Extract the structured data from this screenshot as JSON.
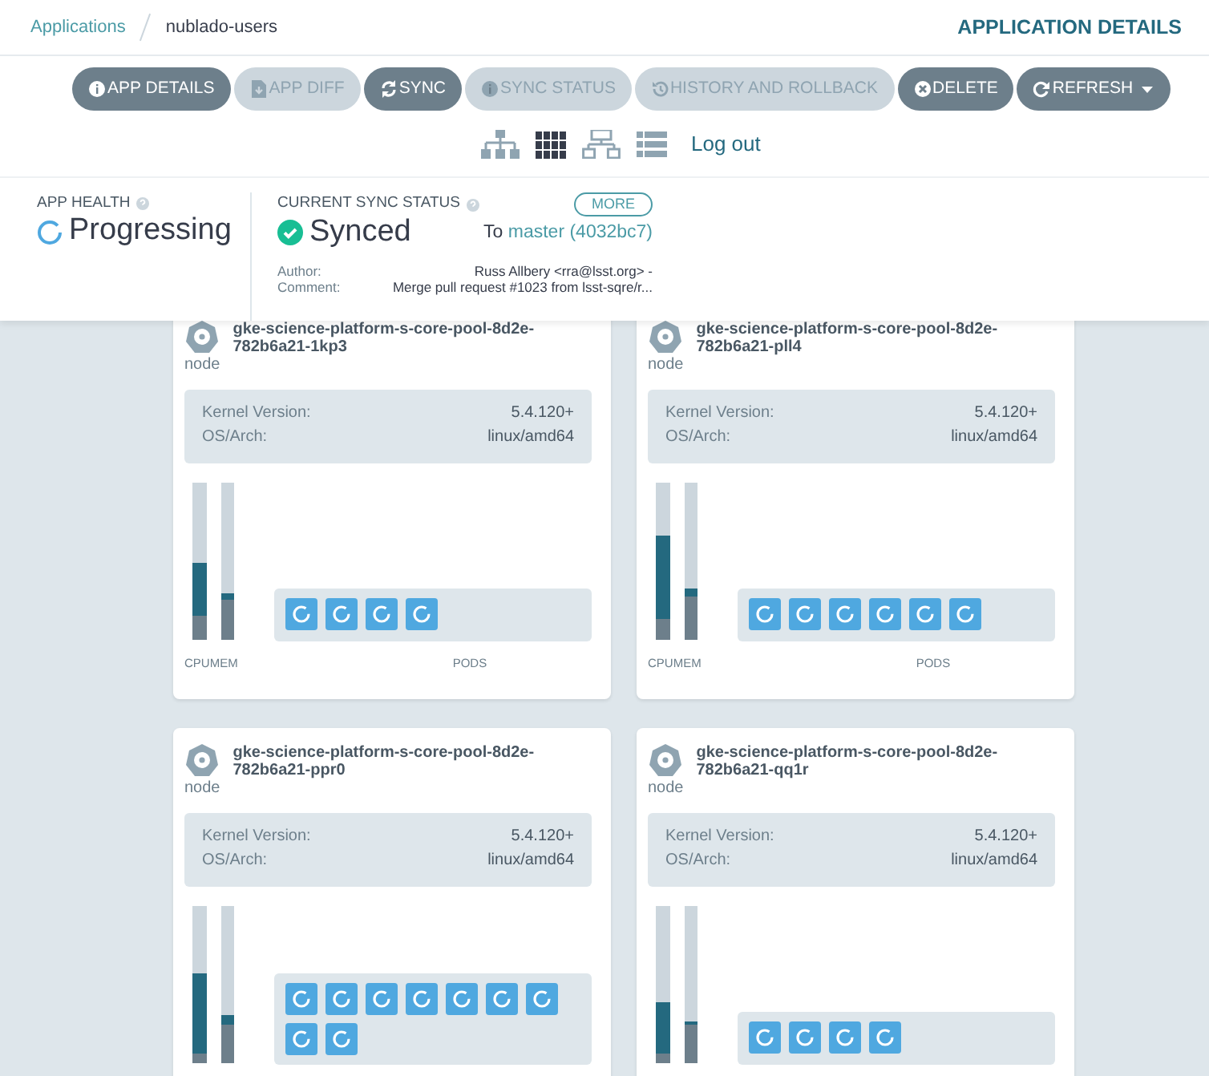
{
  "breadcrumb": {
    "items": [
      {
        "label": "Applications",
        "kind": "link"
      },
      {
        "label": "nublado-users",
        "kind": "current"
      }
    ],
    "page_title": "APPLICATION DETAILS"
  },
  "toolbar": [
    {
      "label": "APP DETAILS",
      "kind": "info",
      "disabled": false
    },
    {
      "label": "APP DIFF",
      "kind": "file",
      "disabled": true
    },
    {
      "label": "SYNC",
      "kind": "sync",
      "disabled": false
    },
    {
      "label": "SYNC STATUS",
      "kind": "info",
      "disabled": true
    },
    {
      "label": "HISTORY AND ROLLBACK",
      "kind": "history",
      "disabled": true
    },
    {
      "label": "DELETE",
      "kind": "close",
      "disabled": false
    },
    {
      "label": "REFRESH",
      "kind": "refresh",
      "disabled": false,
      "dropdown": true
    }
  ],
  "views": [
    {
      "kind": "tree",
      "selected": false
    },
    {
      "kind": "pods",
      "selected": true
    },
    {
      "kind": "network",
      "selected": false
    },
    {
      "kind": "list",
      "selected": false
    }
  ],
  "logout": "Log out",
  "health": {
    "label": "APP HEALTH",
    "status": "Progressing",
    "kind": "progressing"
  },
  "sync": {
    "label": "CURRENT SYNC STATUS",
    "more": "MORE",
    "status": "Synced",
    "kind": "synced",
    "to": "To",
    "revision": "master (4032bc7)",
    "details": [
      {
        "key": "Author:",
        "value": "Russ Allbery <rra@lsst.org> -"
      },
      {
        "key": "Comment:",
        "value": "Merge pull request #1023 from lsst-sqre/r..."
      }
    ]
  },
  "nodes": [
    {
      "type": "node",
      "name": "gke-science-platform-s-core-pool-8d2e-782b6a21-1kp3",
      "info": [
        {
          "key": "Kernel Version:",
          "value": "5.4.120+"
        },
        {
          "key": "OS/Arch:",
          "value": "linux/amd64"
        }
      ],
      "cpu": {
        "level": 0.49,
        "usage": {
          "level": 0.15
        }
      },
      "mem": {
        "level": 0.3,
        "usage": {
          "level": 0.26
        }
      },
      "pods": [
        {
          "kind": "progressing"
        },
        {
          "kind": "progressing"
        },
        {
          "kind": "progressing"
        },
        {
          "kind": "progressing"
        }
      ],
      "axis_labels": {
        "cpu": "CPU",
        "mem": "MEM",
        "pods": "PODS"
      }
    },
    {
      "type": "node",
      "name": "gke-science-platform-s-core-pool-8d2e-782b6a21-pll4",
      "info": [
        {
          "key": "Kernel Version:",
          "value": "5.4.120+"
        },
        {
          "key": "OS/Arch:",
          "value": "linux/amd64"
        }
      ],
      "cpu": {
        "level": 0.66,
        "usage": {
          "level": 0.13
        }
      },
      "mem": {
        "level": 0.33,
        "usage": {
          "level": 0.28
        }
      },
      "pods": [
        {
          "kind": "progressing"
        },
        {
          "kind": "progressing"
        },
        {
          "kind": "progressing"
        },
        {
          "kind": "progressing"
        },
        {
          "kind": "progressing"
        },
        {
          "kind": "progressing"
        }
      ],
      "axis_labels": {
        "cpu": "CPU",
        "mem": "MEM",
        "pods": "PODS"
      }
    },
    {
      "type": "node",
      "name": "gke-science-platform-s-core-pool-8d2e-782b6a21-ppr0",
      "info": [
        {
          "key": "Kernel Version:",
          "value": "5.4.120+"
        },
        {
          "key": "OS/Arch:",
          "value": "linux/amd64"
        }
      ],
      "cpu": {
        "level": 0.57,
        "usage": {
          "level": 0.06
        }
      },
      "mem": {
        "level": 0.31,
        "usage": {
          "level": 0.24
        }
      },
      "pods": [
        {
          "kind": "progressing"
        },
        {
          "kind": "progressing"
        },
        {
          "kind": "progressing"
        },
        {
          "kind": "progressing"
        },
        {
          "kind": "progressing"
        },
        {
          "kind": "progressing"
        },
        {
          "kind": "progressing"
        },
        {
          "kind": "progressing"
        },
        {
          "kind": "progressing"
        }
      ]
    },
    {
      "type": "node",
      "name": "gke-science-platform-s-core-pool-8d2e-782b6a21-qq1r",
      "info": [
        {
          "key": "Kernel Version:",
          "value": "5.4.120+"
        },
        {
          "key": "OS/Arch:",
          "value": "linux/amd64"
        }
      ],
      "cpu": {
        "level": 0.39,
        "usage": {
          "level": 0.06
        }
      },
      "mem": {
        "level": 0.27,
        "usage": {
          "level": 0.24
        }
      },
      "pods": [
        {
          "kind": "progressing"
        },
        {
          "kind": "progressing"
        },
        {
          "kind": "progressing"
        },
        {
          "kind": "progressing"
        }
      ]
    }
  ]
}
